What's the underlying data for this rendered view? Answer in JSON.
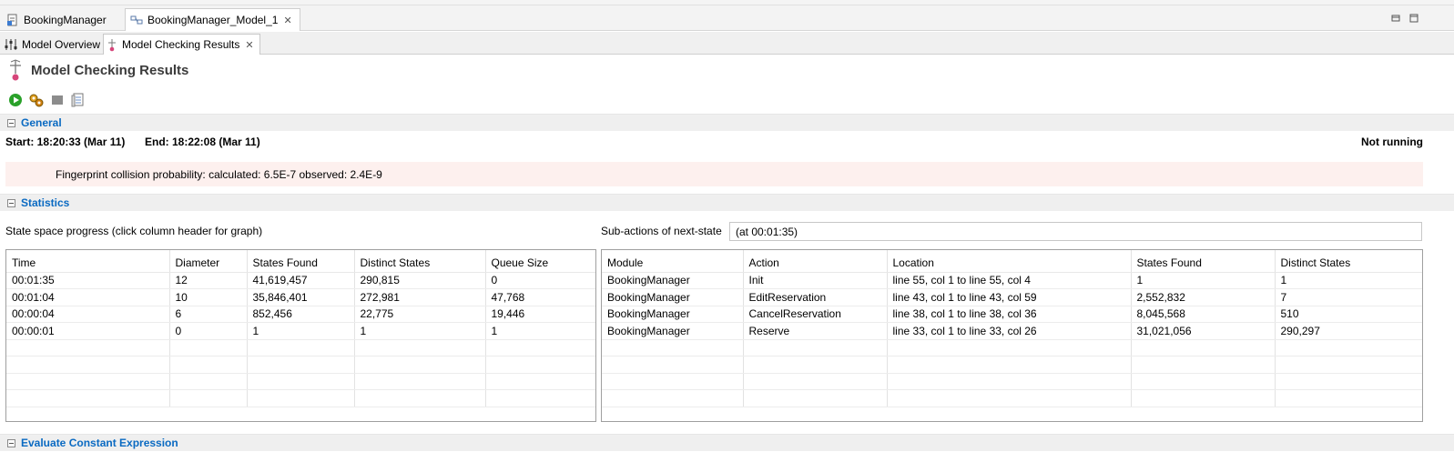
{
  "editor_tabs": [
    {
      "label": "BookingManager"
    },
    {
      "label": "BookingManager_Model_1"
    }
  ],
  "page_tabs": [
    {
      "label": "Model Overview"
    },
    {
      "label": "Model Checking Results"
    }
  ],
  "page_title": "Model Checking Results",
  "general": {
    "section_title": "General",
    "start": "Start: 18:20:33 (Mar 11)",
    "end": "End: 18:22:08 (Mar 11)",
    "status": "Not running",
    "collision": "Fingerprint collision probability: calculated: 6.5E-7  observed: 2.4E-9"
  },
  "statistics": {
    "section_title": "Statistics",
    "progress_label": "State space progress (click column header for graph)",
    "subactions_label": "Sub-actions of next-state",
    "subactions_value": "(at 00:01:35)",
    "progress_columns": [
      "Time",
      "Diameter",
      "States Found",
      "Distinct States",
      "Queue Size"
    ],
    "progress_rows": [
      [
        "00:01:35",
        "12",
        "41,619,457",
        "290,815",
        "0"
      ],
      [
        "00:01:04",
        "10",
        "35,846,401",
        "272,981",
        "47,768"
      ],
      [
        "00:00:04",
        "6",
        "852,456",
        "22,775",
        "19,446"
      ],
      [
        "00:00:01",
        "0",
        "1",
        "1",
        "1"
      ]
    ],
    "action_columns": [
      "Module",
      "Action",
      "Location",
      "States Found",
      "Distinct States"
    ],
    "action_rows": [
      [
        "BookingManager",
        "Init",
        "line 55, col 1 to line 55, col 4",
        "1",
        "1"
      ],
      [
        "BookingManager",
        "EditReservation",
        "line 43, col 1 to line 43, col 59",
        "2,552,832",
        "7"
      ],
      [
        "BookingManager",
        "CancelReservation",
        "line 38, col 1 to line 38, col 36",
        "8,045,568",
        "510"
      ],
      [
        "BookingManager",
        "Reserve",
        "line 33, col 1 to line 33, col 26",
        "31,021,056",
        "290,297"
      ]
    ]
  },
  "evaluate": {
    "section_title": "Evaluate Constant Expression"
  },
  "colors": {
    "section_title": "#0a6ac2",
    "collision_bg": "#fdf0ee",
    "run_green": "#2aa12a"
  }
}
